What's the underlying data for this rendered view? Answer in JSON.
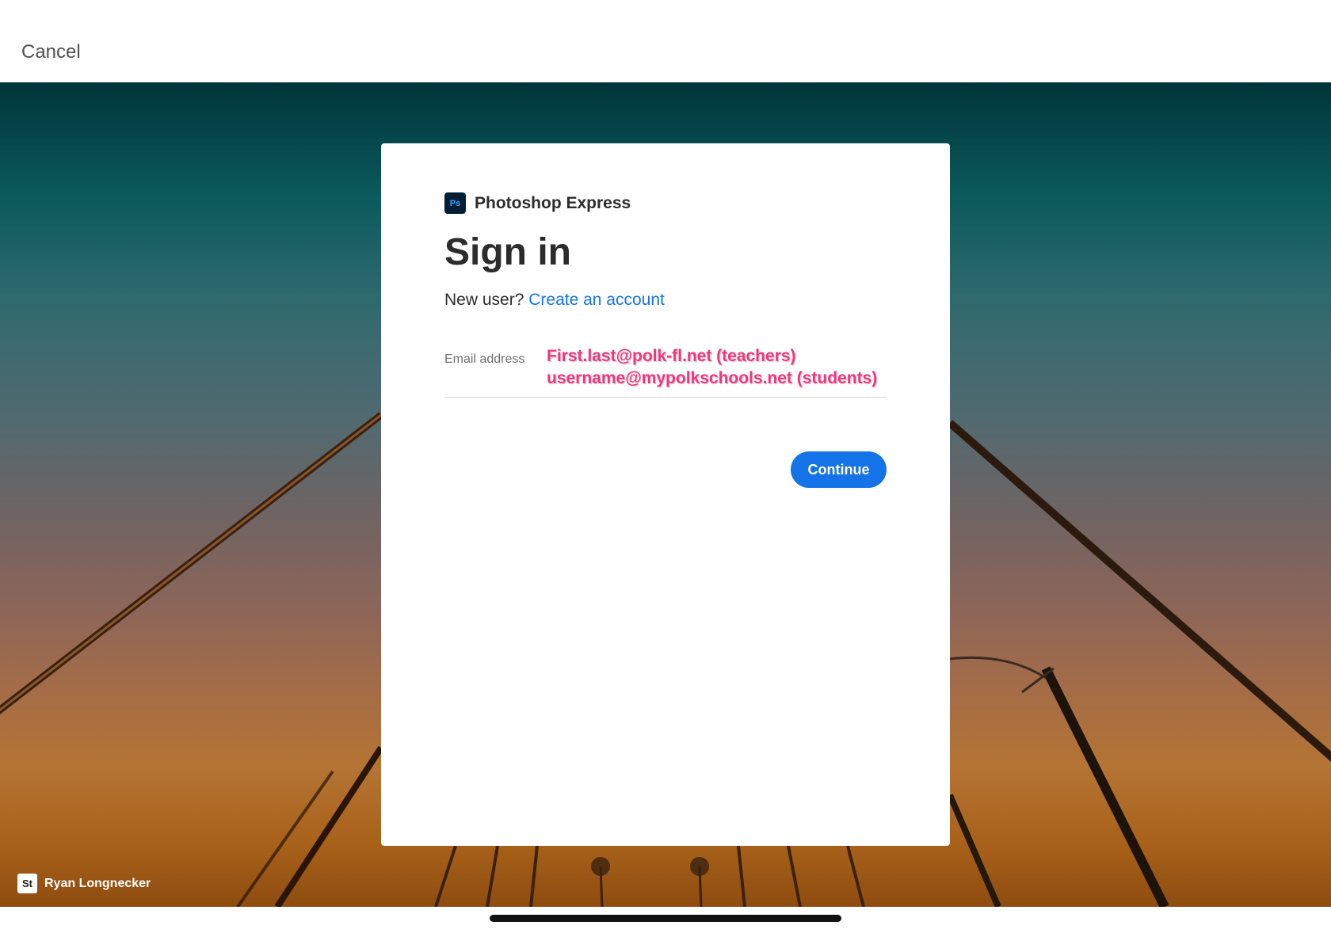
{
  "topbar": {
    "cancel_label": "Cancel"
  },
  "dialog": {
    "app_icon_text": "Ps",
    "app_name": "Photoshop Express",
    "title": "Sign in",
    "new_user_prefix": "New user?",
    "create_account_link": "Create an account",
    "email_label": "Email address",
    "email_value": "",
    "email_note_line1": "First.last@polk-fl.net (teachers)",
    "email_note_line2": "username@mypolkschools.net (students)",
    "continue_label": "Continue"
  },
  "background_credit": {
    "icon_text": "St",
    "photographer": "Ryan Longnecker"
  },
  "colors": {
    "accent_blue": "#1473e6",
    "annotation_pink": "#f0357c",
    "ps_icon_bg": "#001e36"
  }
}
